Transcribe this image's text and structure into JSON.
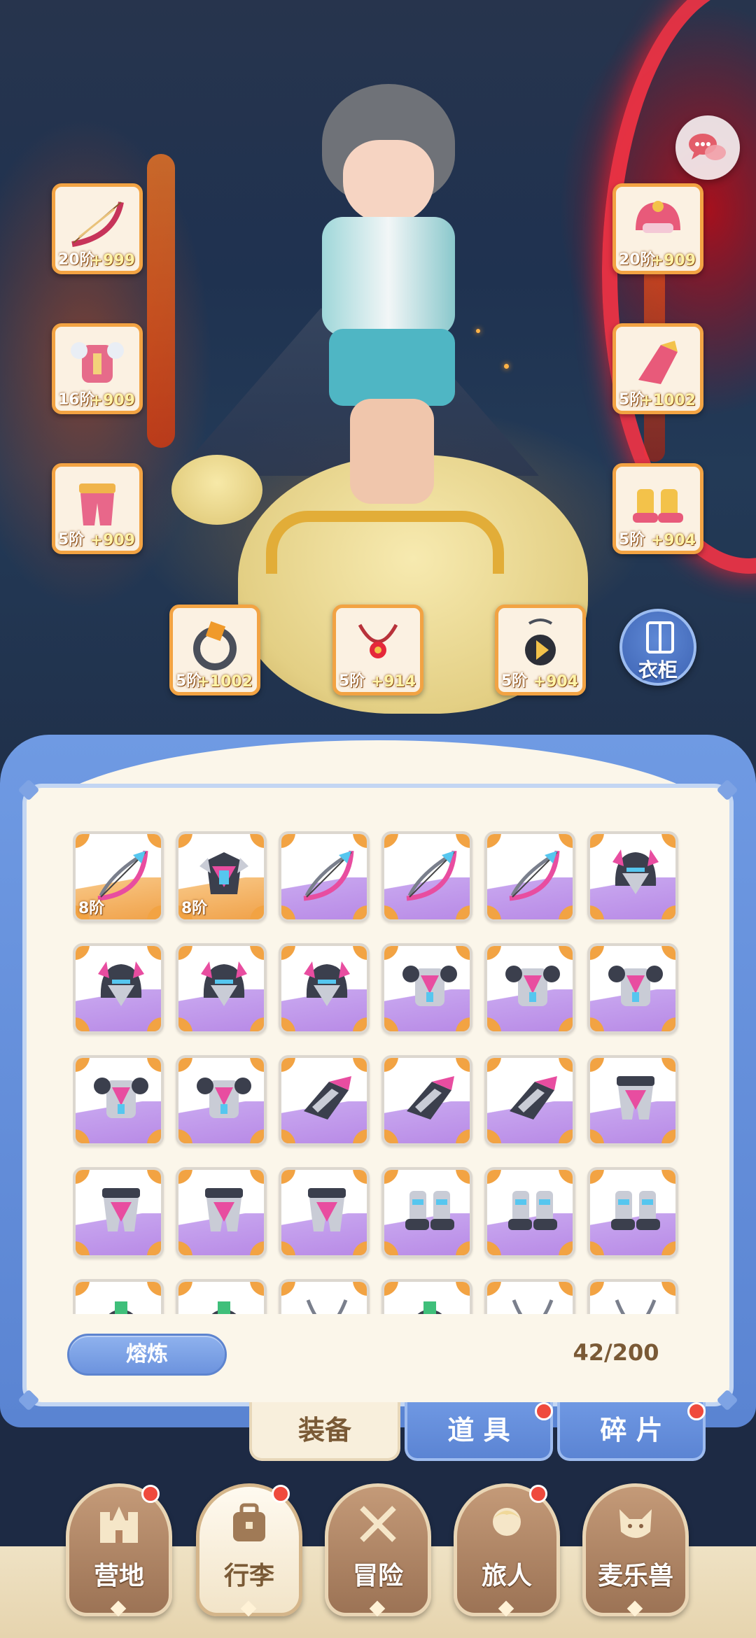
{
  "equipped": {
    "left": [
      {
        "slot": "bow",
        "level": "20阶",
        "bonus": "+999"
      },
      {
        "slot": "armor",
        "level": "16阶",
        "bonus": "+909"
      },
      {
        "slot": "pants",
        "level": "5阶",
        "bonus": "+909"
      }
    ],
    "right": [
      {
        "slot": "helmet",
        "level": "20阶",
        "bonus": "+909"
      },
      {
        "slot": "gauntlet",
        "level": "5阶",
        "bonus": "+1002"
      },
      {
        "slot": "boots",
        "level": "5阶",
        "bonus": "+904"
      }
    ],
    "bottom": [
      {
        "slot": "ring",
        "level": "5阶",
        "bonus": "+1002"
      },
      {
        "slot": "necklace",
        "level": "5阶",
        "bonus": "+914"
      },
      {
        "slot": "amulet",
        "level": "5阶",
        "bonus": "+904"
      }
    ]
  },
  "wardrobe": {
    "label": "衣柜"
  },
  "inventory": {
    "rows": [
      [
        {
          "icon": "bow-icon",
          "rarity": "orange",
          "level": "8阶"
        },
        {
          "icon": "chest-armor-icon",
          "rarity": "orange",
          "level": "8阶"
        },
        {
          "icon": "bow-icon",
          "rarity": "purple",
          "level": ""
        },
        {
          "icon": "bow-icon",
          "rarity": "purple",
          "level": ""
        },
        {
          "icon": "bow-icon",
          "rarity": "purple",
          "level": ""
        },
        {
          "icon": "helmet-icon",
          "rarity": "purple",
          "level": ""
        }
      ],
      [
        {
          "icon": "helmet-icon",
          "rarity": "purple",
          "level": ""
        },
        {
          "icon": "helmet-icon",
          "rarity": "purple",
          "level": ""
        },
        {
          "icon": "helmet-icon",
          "rarity": "purple",
          "level": ""
        },
        {
          "icon": "body-armor-icon",
          "rarity": "purple",
          "level": ""
        },
        {
          "icon": "body-armor-icon",
          "rarity": "purple",
          "level": ""
        },
        {
          "icon": "body-armor-icon",
          "rarity": "purple",
          "level": ""
        }
      ],
      [
        {
          "icon": "body-armor-icon",
          "rarity": "purple",
          "level": ""
        },
        {
          "icon": "body-armor-icon",
          "rarity": "purple",
          "level": ""
        },
        {
          "icon": "gauntlet-icon",
          "rarity": "purple",
          "level": ""
        },
        {
          "icon": "gauntlet-icon",
          "rarity": "purple",
          "level": ""
        },
        {
          "icon": "gauntlet-icon",
          "rarity": "purple",
          "level": ""
        },
        {
          "icon": "leg-armor-icon",
          "rarity": "purple",
          "level": ""
        }
      ],
      [
        {
          "icon": "leg-armor-icon",
          "rarity": "purple",
          "level": ""
        },
        {
          "icon": "leg-armor-icon",
          "rarity": "purple",
          "level": ""
        },
        {
          "icon": "leg-armor-icon",
          "rarity": "purple",
          "level": ""
        },
        {
          "icon": "boots-icon",
          "rarity": "purple",
          "level": ""
        },
        {
          "icon": "boots-icon",
          "rarity": "purple",
          "level": ""
        },
        {
          "icon": "boots-icon",
          "rarity": "purple",
          "level": ""
        }
      ],
      [
        {
          "icon": "ring-icon",
          "rarity": "purple",
          "level": ""
        },
        {
          "icon": "ring-icon",
          "rarity": "purple",
          "level": ""
        },
        {
          "icon": "necklace-icon",
          "rarity": "purple",
          "level": ""
        },
        {
          "icon": "ring-icon",
          "rarity": "purple",
          "level": ""
        },
        {
          "icon": "necklace-icon",
          "rarity": "purple",
          "level": ""
        },
        {
          "icon": "necklace-icon",
          "rarity": "purple",
          "level": ""
        }
      ]
    ],
    "smelt_label": "熔炼",
    "capacity": "42/200"
  },
  "tabs": [
    {
      "label": "装备",
      "active": true,
      "badge": false
    },
    {
      "label": "道 具",
      "active": false,
      "badge": true
    },
    {
      "label": "碎 片",
      "active": false,
      "badge": true
    }
  ],
  "nav": [
    {
      "label": "营地",
      "icon": "castle-icon",
      "active": false,
      "badge": true
    },
    {
      "label": "行李",
      "icon": "backpack-icon",
      "active": true,
      "badge": true
    },
    {
      "label": "冒险",
      "icon": "crossed-swords-icon",
      "active": false,
      "badge": false
    },
    {
      "label": "旅人",
      "icon": "traveler-icon",
      "active": false,
      "badge": true
    },
    {
      "label": "麦乐兽",
      "icon": "pet-icon",
      "active": false,
      "badge": false
    }
  ],
  "colors": {
    "accent_blue": "#6f9ae3",
    "slot_orange": "#f2a343",
    "rarity_purple": "#b88ae6",
    "badge_red": "#ef4a3d"
  }
}
